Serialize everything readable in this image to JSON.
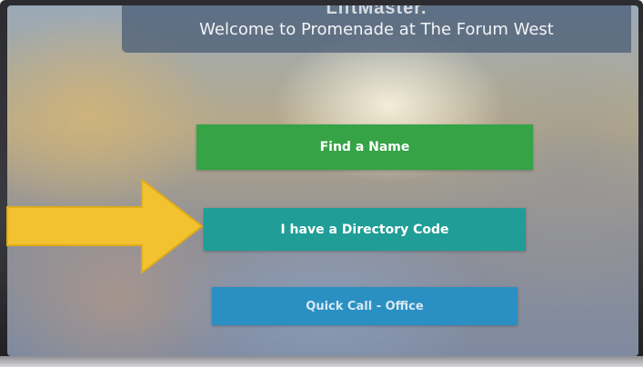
{
  "header": {
    "brand": "LiftMaster.",
    "welcome": "Welcome to Promenade at The Forum West"
  },
  "buttons": {
    "find_name": "Find a Name",
    "directory_code": "I have a Directory Code",
    "quick_call": "Quick Call - Office"
  },
  "annotation": {
    "icon": "arrow-right-icon",
    "color": "#f3c230"
  },
  "colors": {
    "find_name": "#35a346",
    "directory_code": "#1f9d96",
    "quick_call": "#2a8fc3",
    "title_bar": "#465a73"
  }
}
